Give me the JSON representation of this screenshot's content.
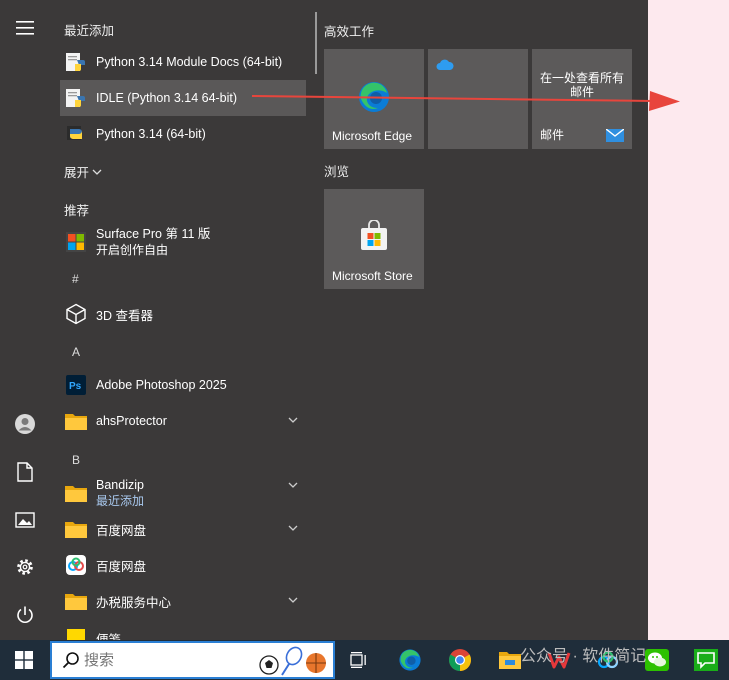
{
  "recent": {
    "heading": "最近添加",
    "items": [
      {
        "label": "Python 3.14 Module Docs (64-bit)"
      },
      {
        "label": "IDLE (Python 3.14 64-bit)"
      },
      {
        "label": "Python 3.14 (64-bit)"
      }
    ],
    "expand_label": "展开"
  },
  "recommended": {
    "heading": "推荐",
    "item": {
      "label": "Surface Pro 第 11 版",
      "sub": "开启创作自由"
    }
  },
  "letters": {
    "hash": "#",
    "a": "A",
    "b": "B"
  },
  "apps": {
    "viewer3d": "3D 查看器",
    "photoshop": "Adobe Photoshop 2025",
    "ahs": "ahsProtector",
    "bandizip": "Bandizip",
    "bandizip_sub": "最近添加",
    "baidu_folder": "百度网盘",
    "baidu_app": "百度网盘",
    "tax": "办税服务中心",
    "notes": "便笺"
  },
  "tiles": {
    "group1": "高效工作",
    "edge": "Microsoft Edge",
    "mail_title": "在一处查看所有邮件",
    "mail": "邮件",
    "group2": "浏览",
    "store": "Microsoft Store"
  },
  "taskbar": {
    "search_placeholder": "搜索"
  },
  "watermark": "公众号 · 软件简记",
  "colors": {
    "menu_bg": "#3b3939",
    "tile_bg": "#5c5a5a",
    "arrow": "#e8453c",
    "taskbar_bg": "#1f2d3a",
    "accent": "#2a7fd4"
  }
}
